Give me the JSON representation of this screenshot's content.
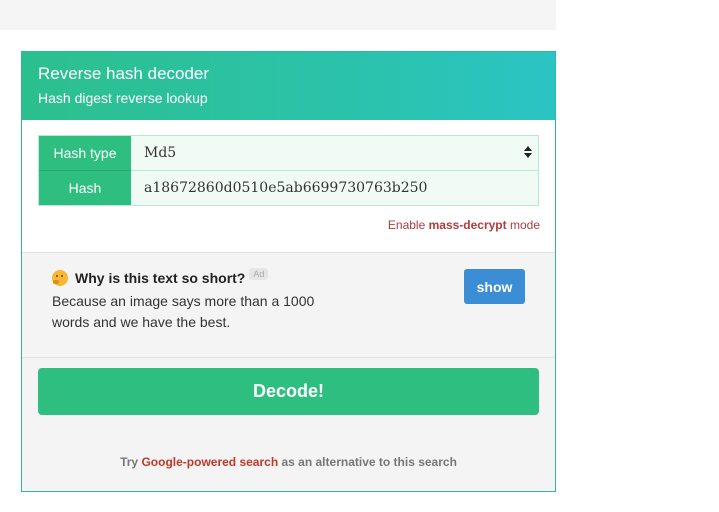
{
  "panel": {
    "title": "Reverse hash decoder",
    "subtitle": "Hash digest reverse lookup"
  },
  "form": {
    "hash_type_label": "Hash type",
    "hash_type_value": "Md5",
    "hash_label": "Hash",
    "hash_value": "a18672860d0510e5ab6699730763b250",
    "mass_prefix": "Enable ",
    "mass_link": "mass-decrypt",
    "mass_suffix": " mode"
  },
  "ad": {
    "title": "Why is this text so short?",
    "badge": "Ad",
    "body": "Because an image says more than a 1000 words and we have the best.",
    "show_button": "show"
  },
  "decode_button": "Decode!",
  "alternative": {
    "prefix": "Try ",
    "link": "Google-powered search",
    "suffix": " as an alternative to this search"
  },
  "icons": {
    "ad_icon": "thinking-face-icon",
    "select_icon": "select-arrows-icon"
  },
  "colors": {
    "header": "#2cbf8d",
    "green": "#2ebf80",
    "show_button": "#3b8ed4",
    "link_red": "#c0392b"
  }
}
